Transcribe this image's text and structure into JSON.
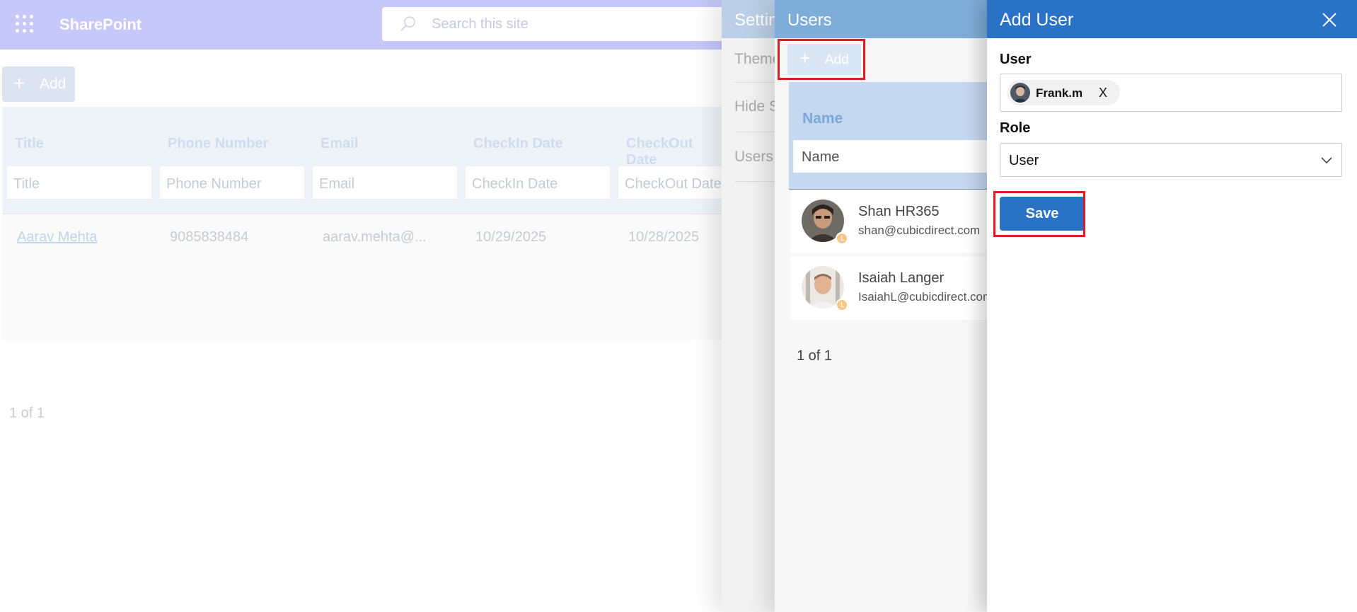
{
  "header": {
    "app_name": "SharePoint",
    "search_placeholder": "Search this site"
  },
  "page": {
    "add_label": "Add",
    "columns": [
      "Title",
      "Phone Number",
      "Email",
      "CheckIn Date",
      "CheckOut Date"
    ],
    "filter_placeholders": [
      "Title",
      "Phone Number",
      "Email",
      "CheckIn Date",
      "CheckOut Date"
    ],
    "rows": [
      {
        "title": "Aarav Mehta",
        "phone": "9085838484",
        "email": "aarav.mehta@...",
        "checkin": "10/29/2025",
        "checkout": "10/28/2025"
      }
    ],
    "pagination": "1 of 1"
  },
  "settings": {
    "title": "Settings",
    "items": [
      "Theme",
      "Hide S",
      "Users"
    ]
  },
  "users_panel": {
    "title": "Users",
    "add_label": "Add",
    "name_header": "Name",
    "name_filter": "Name",
    "users": [
      {
        "name": "Shan HR365",
        "email": "shan@cubicdirect.com"
      },
      {
        "name": "Isaiah Langer",
        "email": "IsaiahL@cubicdirect.com"
      }
    ],
    "pagination": "1 of 1"
  },
  "add_user": {
    "title": "Add User",
    "user_label": "User",
    "selected_user": "Frank.m",
    "remove_label": "X",
    "role_label": "Role",
    "role_value": "User",
    "save_label": "Save"
  },
  "colors": {
    "accent": "#2a72c6",
    "highlight": "#e01b24",
    "topbar": "#c5c8f8"
  }
}
